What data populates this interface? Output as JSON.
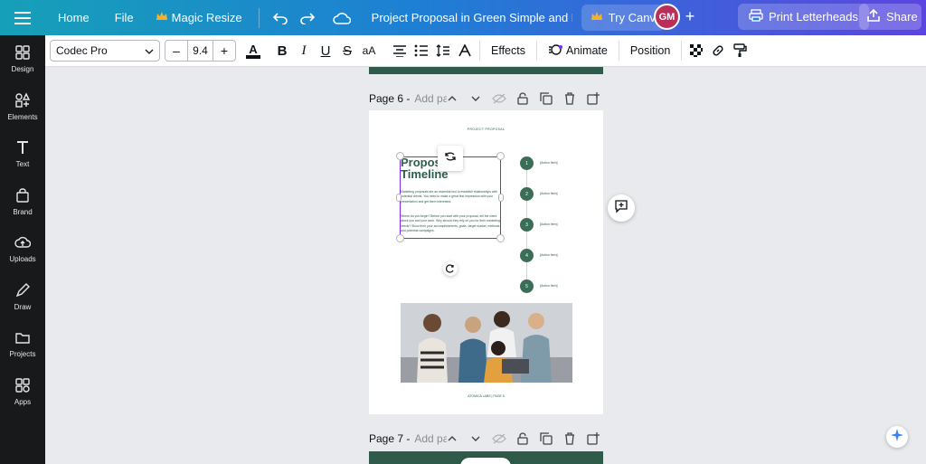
{
  "topbar": {
    "home": "Home",
    "file": "File",
    "magic_resize": "Magic Resize",
    "doc_title": "Project Proposal in Green Simple and Minimal Style",
    "try_canva": "Try Canva Pro",
    "avatar_initials": "GM",
    "print": "Print Letterheads",
    "share": "Share"
  },
  "sidebar": {
    "items": [
      {
        "label": "Design",
        "icon": "design-icon"
      },
      {
        "label": "Elements",
        "icon": "elements-icon"
      },
      {
        "label": "Text",
        "icon": "text-icon"
      },
      {
        "label": "Brand",
        "icon": "brand-icon"
      },
      {
        "label": "Uploads",
        "icon": "uploads-icon"
      },
      {
        "label": "Draw",
        "icon": "draw-icon"
      },
      {
        "label": "Projects",
        "icon": "projects-icon"
      },
      {
        "label": "Apps",
        "icon": "apps-icon"
      }
    ]
  },
  "toolbar": {
    "font": "Codec Pro",
    "size_minus": "–",
    "size": "9.4",
    "size_plus": "+",
    "text_color": "#0e1318",
    "effects": "Effects",
    "animate": "Animate",
    "position": "Position"
  },
  "page6": {
    "label": "Page 6 -",
    "title_placeholder": "Add page title",
    "header": "PROJECT PROPOSAL",
    "heading_line1": "Proposal",
    "heading_line2": "Timeline",
    "para1": "Marketing proposals are an essential tool to establish relationships with potential clients. You need to make a great first impression with your presentation and get them interested.",
    "para2": "Where do you begin? Before you start with your proposal, tell the client about you and your work. Why should they rely on you for their marketing needs? Show their your accomplishments, goals, target market, methods and potential campaigns.",
    "timeline": [
      {
        "num": "1",
        "text": "[Action Item]"
      },
      {
        "num": "2",
        "text": "[Action Item]"
      },
      {
        "num": "3",
        "text": "[Action Item]"
      },
      {
        "num": "4",
        "text": "[Action Item]"
      },
      {
        "num": "5",
        "text": "[Action Item]"
      }
    ],
    "footer": "ATOMICA LABS | PAGE 6"
  },
  "page7": {
    "label": "Page 7 -",
    "title_placeholder": "Add page title"
  },
  "colors": {
    "brand_green": "#2f5c4a",
    "accent_purple": "#7d2ae8",
    "sidebar_bg": "#18191b"
  }
}
